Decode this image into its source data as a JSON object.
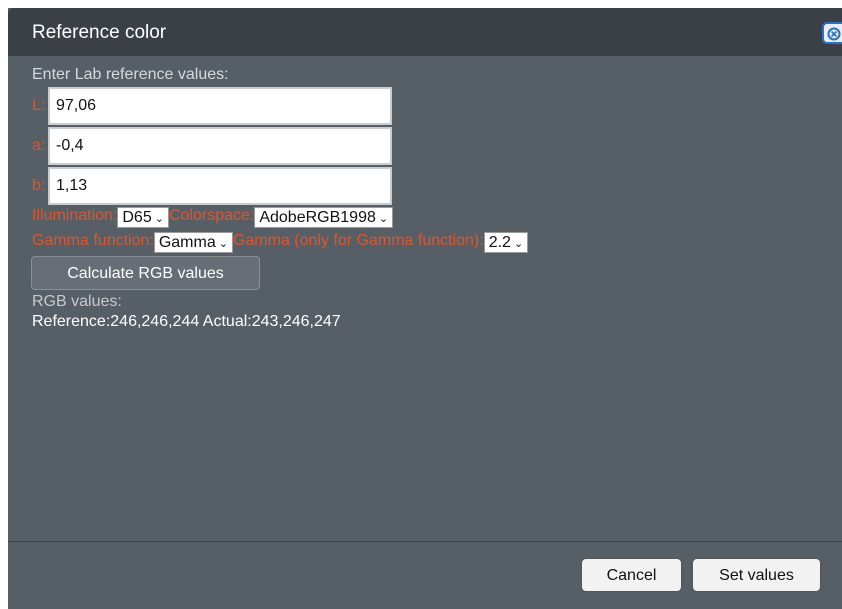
{
  "dialog": {
    "title": "Reference color",
    "close_icon": "close-icon",
    "prompt": "Enter Lab reference values:"
  },
  "lab": {
    "l_label": "L:",
    "l_value": "97,06",
    "a_label": "a:",
    "a_value": "-0,4",
    "b_label": "b:",
    "b_value": "1,13"
  },
  "options": {
    "illumination_label": "Illumination:",
    "illumination_value": "D65",
    "colorspace_label": "Colorspace:",
    "colorspace_value": "AdobeRGB1998",
    "gamma_function_label": "Gamma function:",
    "gamma_function_value": "Gamma",
    "gamma_label": "Gamma (only for Gamma function):",
    "gamma_value": "2.2"
  },
  "calculate_label": "Calculate RGB values",
  "results": {
    "heading": "RGB values:",
    "text": "Reference:246,246,244 Actual:243,246,247"
  },
  "footer": {
    "cancel_label": "Cancel",
    "set_label": "Set values"
  },
  "colors": {
    "accent_label": "#e0542a",
    "dialog_bg": "#575f66",
    "titlebar_bg": "#3a4046"
  }
}
